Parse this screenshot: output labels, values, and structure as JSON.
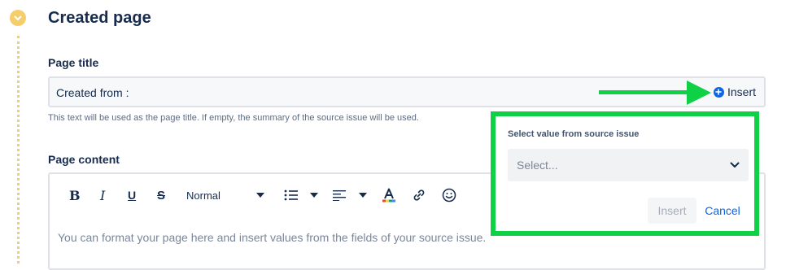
{
  "section": {
    "heading": "Created page"
  },
  "page_title": {
    "label": "Page title",
    "value": "Created from :",
    "insert_label": "Insert",
    "helper": "This text will be used as the page title. If empty, the summary of the source issue will be used."
  },
  "page_content": {
    "label": "Page content",
    "toolbar": {
      "bold": "B",
      "italic": "I",
      "underline": "U",
      "strike": "S",
      "text_style": "Normal"
    },
    "placeholder": "You can format your page here and insert values from the fields of your source issue."
  },
  "popup": {
    "label": "Select value from source issue",
    "select_placeholder": "Select...",
    "insert_label": "Insert",
    "cancel_label": "Cancel"
  },
  "colors": {
    "accent": "#0c66e4",
    "annotation": "#0ed145",
    "step": "#f5cd6a"
  },
  "icons": [
    "chevron-down-icon",
    "plus-circle-icon",
    "bullet-list-icon",
    "align-icon",
    "text-color-icon",
    "link-icon",
    "emoji-icon"
  ]
}
